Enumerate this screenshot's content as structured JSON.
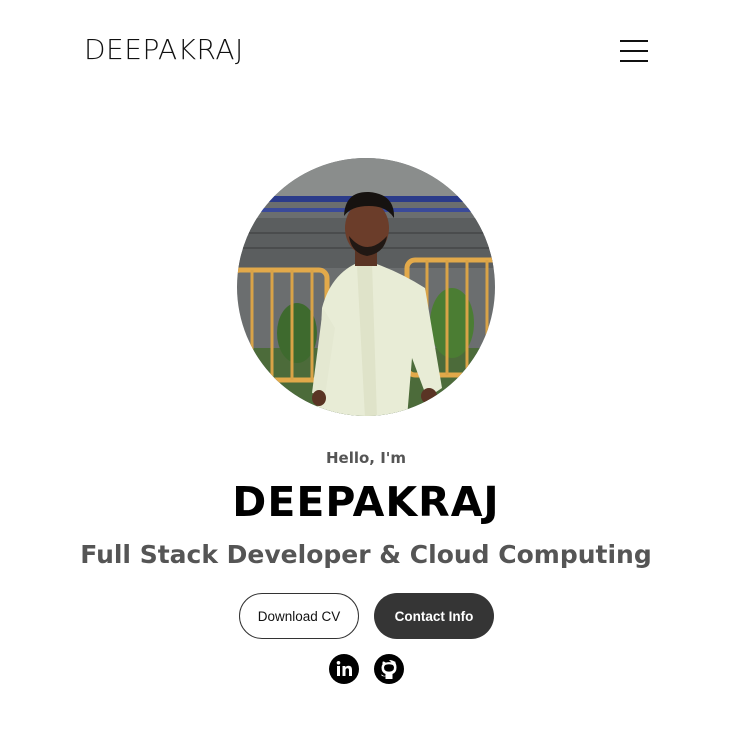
{
  "header": {
    "logo": "DEEPAKRAJ",
    "menu_icon": "hamburger-menu-icon"
  },
  "hero": {
    "profile_image": "profile-photo",
    "greeting": "Hello, I'm",
    "name": "DEEPAKRAJ",
    "subtitle": "Full Stack Developer & Cloud Computing"
  },
  "buttons": {
    "download_cv": "Download CV",
    "contact_info": "Contact Info"
  },
  "socials": [
    {
      "icon": "linkedin-icon"
    },
    {
      "icon": "github-icon"
    }
  ],
  "colors": {
    "background": "#ffffff",
    "primary_text": "#000000",
    "secondary_text": "#555555",
    "button_dark": "#353535"
  }
}
